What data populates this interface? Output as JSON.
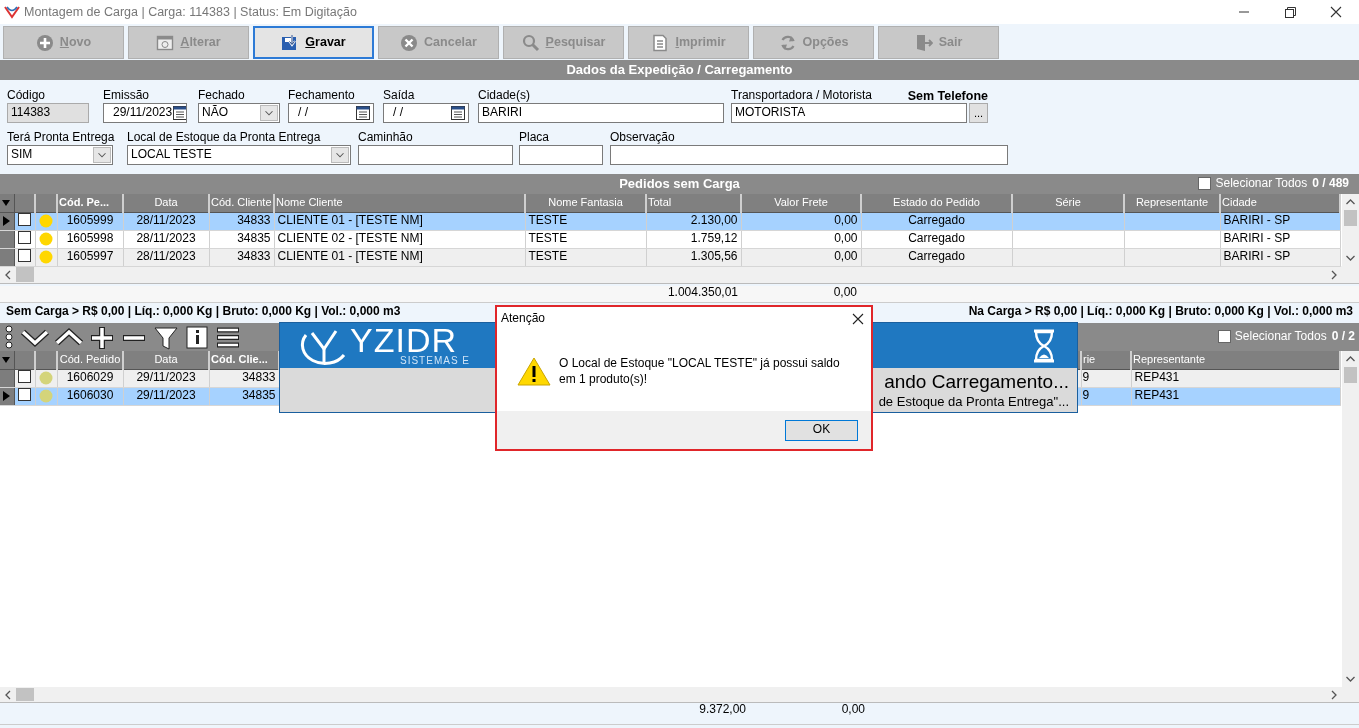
{
  "window": {
    "title": "Montagem de Carga | Carga: 114383 | Status: Em Digitação"
  },
  "toolbar": [
    {
      "label": "Novo",
      "disabled": true,
      "focused": false,
      "mnemonic": true
    },
    {
      "label": "Alterar",
      "disabled": true,
      "focused": false,
      "mnemonic": true
    },
    {
      "label": "Gravar",
      "disabled": false,
      "focused": true,
      "mnemonic": true
    },
    {
      "label": "Cancelar",
      "disabled": true,
      "focused": false,
      "mnemonic": false
    },
    {
      "label": "Pesquisar",
      "disabled": true,
      "focused": false,
      "mnemonic": true
    },
    {
      "label": "Imprimir",
      "disabled": true,
      "focused": false,
      "mnemonic": true
    },
    {
      "label": "Opções",
      "disabled": true,
      "focused": false,
      "mnemonic": false
    },
    {
      "label": "Sair",
      "disabled": true,
      "focused": false,
      "mnemonic": false
    }
  ],
  "expedition": {
    "title": "Dados da Expedição / Carregamento",
    "phone_status": "Sem Telefone",
    "fields": [
      {
        "label": "Código",
        "value": "114383",
        "kind": "text",
        "disabled": true
      },
      {
        "label": "Emissão",
        "value": "29/11/2023",
        "kind": "date",
        "disabled": false
      },
      {
        "label": "Fechado",
        "value": "NÃO",
        "kind": "combo",
        "disabled": false
      },
      {
        "label": "Fechamento",
        "value": "/ /",
        "kind": "date",
        "disabled": false
      },
      {
        "label": "Saída",
        "value": "/ /",
        "kind": "date",
        "disabled": false
      },
      {
        "label": "Cidade(s)",
        "value": "BARIRI",
        "kind": "text",
        "disabled": false
      },
      {
        "label": "Transportadora / Motorista",
        "value": "MOTORISTA",
        "kind": "lookup",
        "button": "...",
        "disabled": false
      },
      {
        "label": "Terá Pronta Entrega",
        "value": "SIM",
        "kind": "combo",
        "disabled": false
      },
      {
        "label": "Local de Estoque da Pronta Entrega",
        "value": "LOCAL TESTE",
        "kind": "combo",
        "disabled": false
      },
      {
        "label": "Caminhão",
        "kind": "text",
        "disabled": false
      },
      {
        "label": "Placa",
        "kind": "text",
        "disabled": false
      },
      {
        "label": "Observação",
        "kind": "text",
        "disabled": false
      }
    ]
  },
  "orders_without_load": {
    "title": "Pedidos sem Carga",
    "select_all": {
      "label": "Selecionar Todos",
      "checked": false
    },
    "count": "0 / 489",
    "columns": [
      {
        "label": "Cód. Pe...",
        "bold": true
      },
      {
        "label": "Data",
        "bold": false
      },
      {
        "label": "Cód. Cliente",
        "bold": false
      },
      {
        "label": "Nome Cliente",
        "bold": false
      },
      {
        "label": "Nome Fantasia",
        "bold": false
      },
      {
        "label": "Total",
        "bold": false
      },
      {
        "label": "Valor Frete",
        "bold": false
      },
      {
        "label": "Estado do Pedido",
        "bold": false
      },
      {
        "label": "Série",
        "bold": false
      },
      {
        "label": "Representante",
        "bold": false
      },
      {
        "label": "Cidade",
        "bold": false
      }
    ],
    "rows": [
      {
        "selected": true,
        "current": true,
        "checked": false,
        "color": "#ffd700",
        "cells": [
          "1605999",
          "28/11/2023",
          "34833",
          "CLIENTE 01 - [TESTE NM]",
          "TESTE",
          "2.130,00",
          "0,00",
          "Carregado",
          "",
          "",
          "BARIRI - SP"
        ]
      },
      {
        "selected": false,
        "current": false,
        "checked": false,
        "color": "#ffd700",
        "cells": [
          "1605998",
          "28/11/2023",
          "34835",
          "CLIENTE 02 - [TESTE NM]",
          "TESTE",
          "1.759,12",
          "0,00",
          "Carregado",
          "",
          "",
          "BARIRI - SP"
        ]
      },
      {
        "selected": false,
        "current": false,
        "checked": false,
        "color": "#ffd700",
        "cells": [
          "1605997",
          "28/11/2023",
          "34833",
          "CLIENTE 01 - [TESTE NM]",
          "TESTE",
          "1.305,56",
          "0,00",
          "Carregado",
          "",
          "",
          "BARIRI - SP"
        ]
      }
    ],
    "totals": [
      "1.004.350,01",
      "0,00"
    ]
  },
  "summary": {
    "left": "Sem Carga > R$ 0,00 | Líq.: 0,000 Kg | Bruto: 0,000 Kg | Vol.: 0,000 m3",
    "right": "Na Carga > R$ 0,00 | Líq.: 0,000 Kg | Bruto: 0,000 Kg | Vol.: 0,000 m3"
  },
  "orders_in_load": {
    "select_all": {
      "label": "Selecionar Todos",
      "checked": false
    },
    "count": "0 / 2",
    "columns": [
      {
        "label": "Cód. Pedido",
        "bold": false
      },
      {
        "label": "Data",
        "bold": false
      },
      {
        "label": "Cód. Clie...",
        "bold": true
      },
      {
        "label": "rie",
        "bold": false
      },
      {
        "label": "Representante",
        "bold": false
      }
    ],
    "rows": [
      {
        "selected": false,
        "current": false,
        "checked": false,
        "color": "#d4d47a",
        "cells": [
          "1606029",
          "29/11/2023",
          "34833",
          "9",
          "REP431"
        ]
      },
      {
        "selected": true,
        "current": true,
        "checked": false,
        "color": "#d4d47a",
        "cells": [
          "1606030",
          "29/11/2023",
          "34835",
          "9",
          "REP431"
        ]
      }
    ],
    "totals": [
      "9.372,00",
      "0,00"
    ]
  },
  "loading": {
    "logo": "YZIDR",
    "logo_subtitle": "SISTEMAS E",
    "message": "ando Carregamento...",
    "detail": "de Estoque da Pronta Entrega\"..."
  },
  "dialog": {
    "title": "Atenção",
    "message": "O Local de Estoque \"LOCAL TESTE\" já possui saldo em 1 produto(s)!",
    "button": "OK"
  }
}
